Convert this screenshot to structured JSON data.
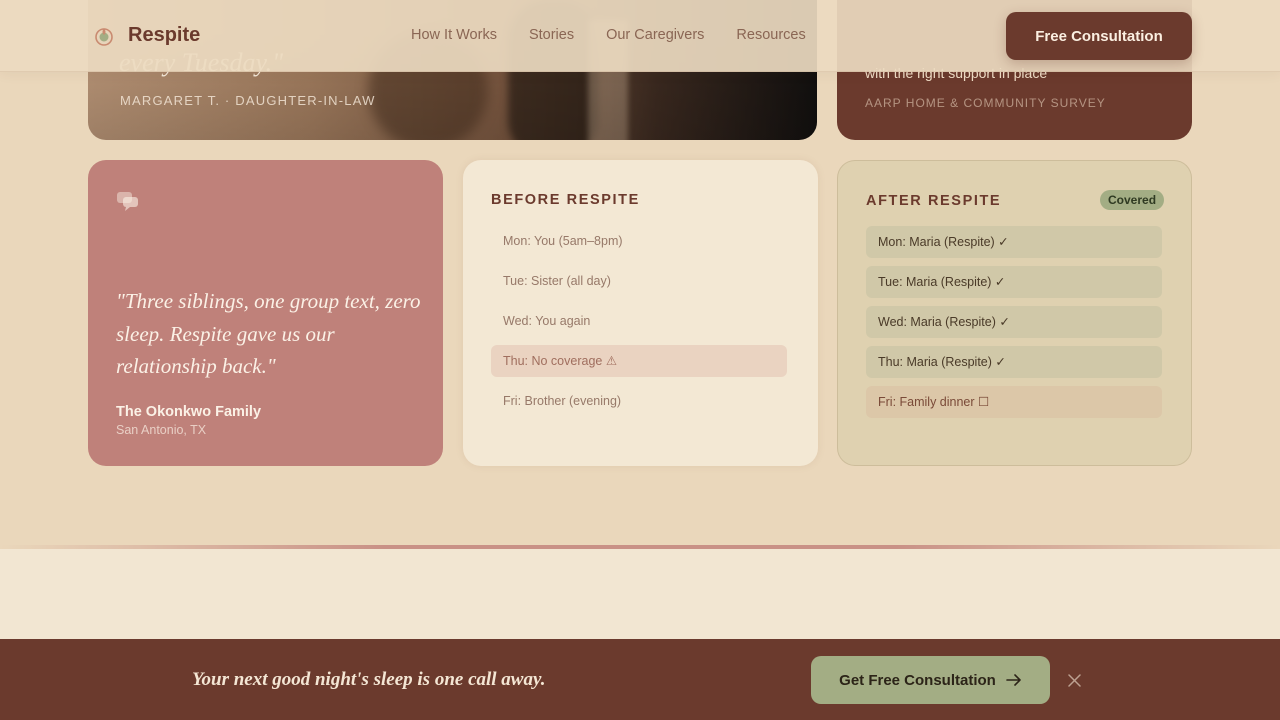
{
  "header": {
    "brand": "Respite",
    "nav": [
      "How It Works",
      "Stories",
      "Our Caregivers",
      "Resources"
    ],
    "cta_label": "Free Consultation"
  },
  "hero": {
    "quote_fragment": "every Tuesday.\"",
    "attribution": "MARGARET T. · DAUGHTER-IN-LAW"
  },
  "stat": {
    "text": "with the right support in place",
    "source": "AARP HOME & COMMUNITY SURVEY"
  },
  "testimonial": {
    "quote": "\"Three siblings, one group text, zero sleep. Respite gave us our relationship back.\"",
    "name": "The Okonkwo Family",
    "location": "San Antonio, TX"
  },
  "before": {
    "title": "BEFORE RESPITE",
    "items": [
      "Mon: You (5am–8pm)",
      "Tue: Sister (all day)",
      "Wed: You again",
      "Thu: No coverage ⚠",
      "Fri: Brother (evening)"
    ]
  },
  "after": {
    "title": "AFTER RESPITE",
    "badge": "Covered",
    "items": [
      "Mon: Maria (Respite) ✓",
      "Tue: Maria (Respite) ✓",
      "Wed: Maria (Respite) ✓",
      "Thu: Maria (Respite) ✓",
      "Fri: Family dinner ☐"
    ]
  },
  "sticky": {
    "text": "Your next good night's sleep is one call away.",
    "cta_label": "Get Free Consultation"
  },
  "colors": {
    "brand_brown": "#6b3a2d",
    "sage": "#a3ad84",
    "rose": "#bf817a",
    "cream": "#f3e8d4"
  }
}
